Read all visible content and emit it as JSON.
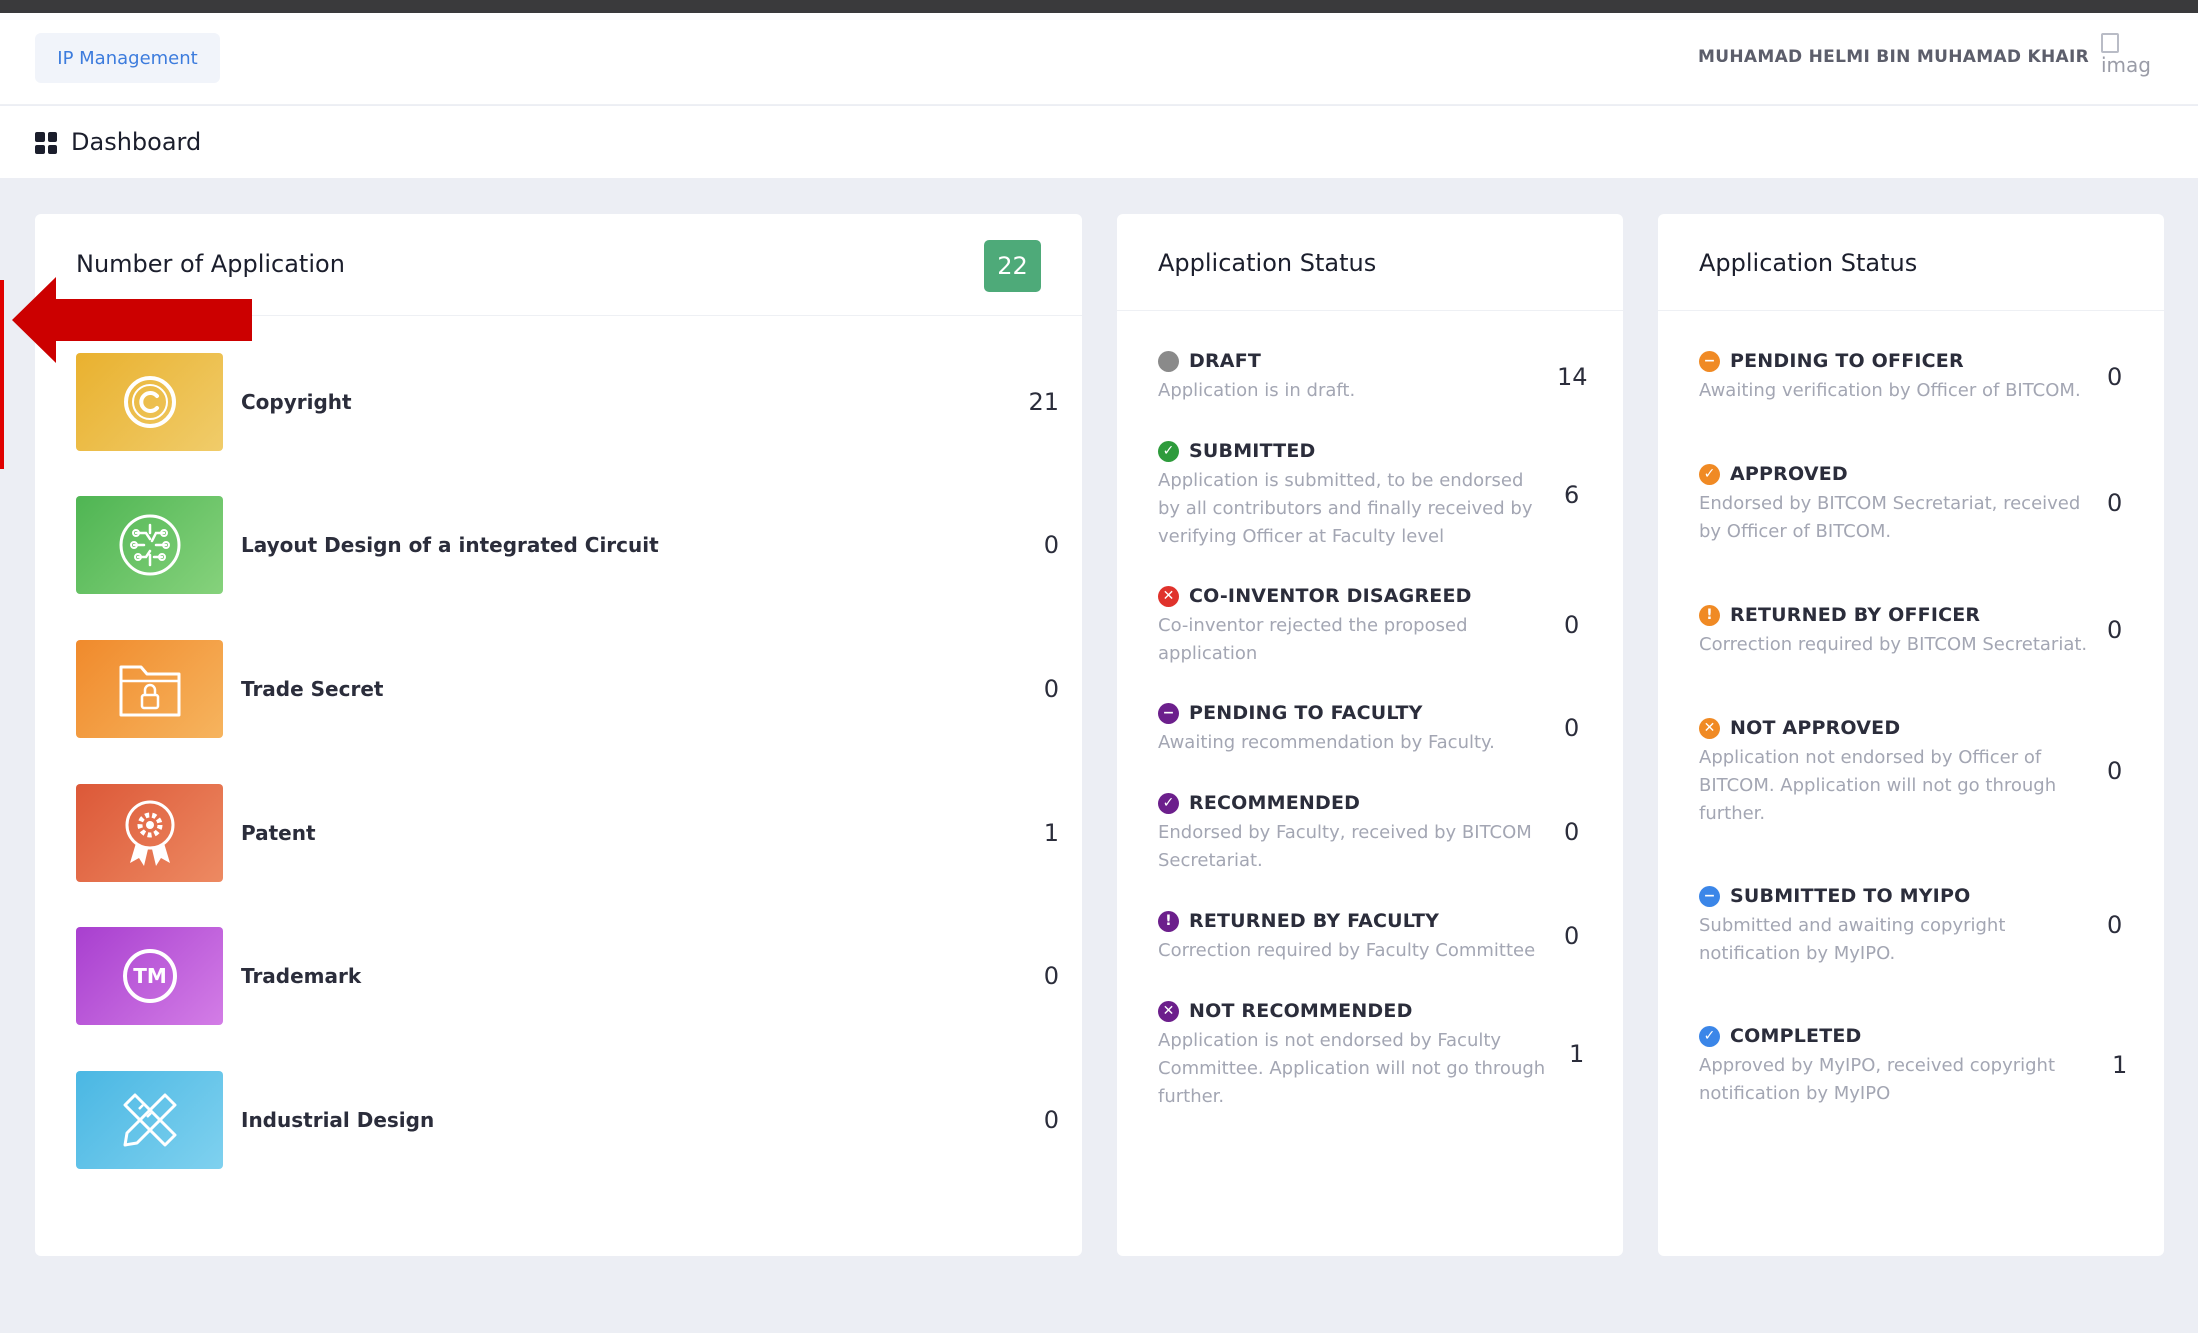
{
  "navbar": {
    "module_button": "IP Management",
    "user_name": "MUHAMAD HELMI BIN MUHAMAD KHAIR",
    "avatar_alt": "imag"
  },
  "page": {
    "title": "Dashboard"
  },
  "applications": {
    "title": "Number of Application",
    "total": "22",
    "categories": [
      {
        "label": "Copyright",
        "count": "21",
        "icon": "copyright-icon",
        "color": "#e8b73b"
      },
      {
        "label": "Layout Design of a integrated Circuit",
        "count": "0",
        "icon": "circuit-brain-icon",
        "color": "#5dbd62"
      },
      {
        "label": "Trade Secret",
        "count": "0",
        "icon": "locked-folder-icon",
        "color": "#f29b3b"
      },
      {
        "label": "Patent",
        "count": "1",
        "icon": "award-gear-icon",
        "color": "#e0643f"
      },
      {
        "label": "Trademark",
        "count": "0",
        "icon": "trademark-icon",
        "color": "#b74bd4"
      },
      {
        "label": "Industrial Design",
        "count": "0",
        "icon": "ruler-pencil-icon",
        "color": "#5cc0e8"
      }
    ]
  },
  "status_faculty": {
    "title": "Application Status",
    "items": [
      {
        "name": "DRAFT",
        "desc": "Application is in draft.",
        "count": "14",
        "icon": "circle-icon",
        "color": "#8a8a8a"
      },
      {
        "name": "SUBMITTED",
        "desc": "Application is submitted, to be endorsed by all contributors and finally received by verifying Officer at Faculty level",
        "count": "6",
        "icon": "check-circle-icon",
        "color": "#2e9b3c"
      },
      {
        "name": "CO-INVENTOR DISAGREED",
        "desc": "Co-inventor rejected the proposed application",
        "count": "0",
        "icon": "x-circle-icon",
        "color": "#e0322c"
      },
      {
        "name": "PENDING TO FACULTY",
        "desc": "Awaiting recommendation by Faculty.",
        "count": "0",
        "icon": "minus-circle-icon",
        "color": "#6c1f8c"
      },
      {
        "name": "RECOMMENDED",
        "desc": "Endorsed by Faculty, received by BITCOM Secretariat.",
        "count": "0",
        "icon": "check-circle-icon",
        "color": "#6c1f8c"
      },
      {
        "name": "RETURNED BY FACULTY",
        "desc": "Correction required by Faculty Committee",
        "count": "0",
        "icon": "exclamation-circle-icon",
        "color": "#6c1f8c"
      },
      {
        "name": "NOT RECOMMENDED",
        "desc": "Application is not endorsed by Faculty Committee. Application will not go through further.",
        "count": "1",
        "icon": "x-circle-icon",
        "color": "#6c1f8c"
      }
    ]
  },
  "status_bitcom": {
    "title": "Application Status",
    "items": [
      {
        "name": "PENDING TO OFFICER",
        "desc": "Awaiting verification by Officer of BITCOM.",
        "count": "0",
        "icon": "minus-circle-icon",
        "color": "#f08a24"
      },
      {
        "name": "APPROVED",
        "desc": "Endorsed by BITCOM Secretariat, received by Officer of BITCOM.",
        "count": "0",
        "icon": "check-circle-icon",
        "color": "#f08a24"
      },
      {
        "name": "RETURNED BY OFFICER",
        "desc": "Correction required by BITCOM Secretariat.",
        "count": "0",
        "icon": "exclamation-circle-icon",
        "color": "#f08a24"
      },
      {
        "name": "NOT APPROVED",
        "desc": "Application not endorsed by Officer of BITCOM. Application will not go through further.",
        "count": "0",
        "icon": "x-circle-icon",
        "color": "#f08a24"
      },
      {
        "name": "SUBMITTED TO MYIPO",
        "desc": "Submitted and awaiting copyright notification by MyIPO.",
        "count": "0",
        "icon": "minus-circle-icon",
        "color": "#3b86e8"
      },
      {
        "name": "COMPLETED",
        "desc": "Approved by MyIPO, received copyright notification by MyIPO",
        "count": "1",
        "icon": "check-circle-icon",
        "color": "#3b86e8"
      }
    ]
  },
  "annotation": {
    "color": "#cc0000",
    "icon": "left-arrow-annotation"
  }
}
